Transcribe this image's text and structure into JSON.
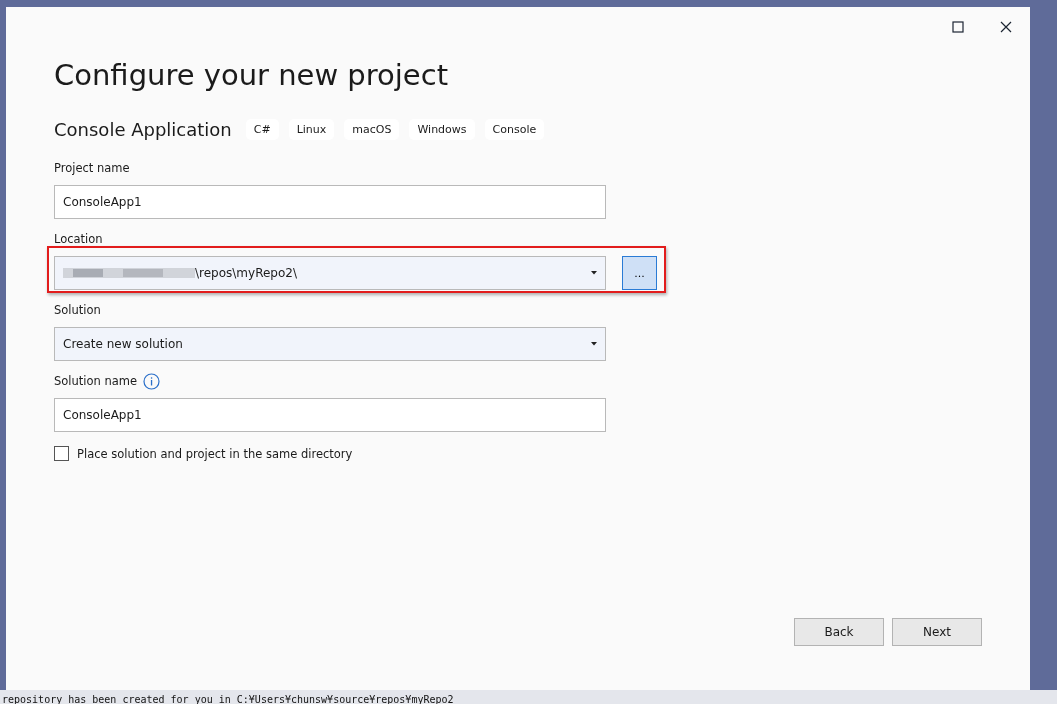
{
  "window": {
    "title": "Configure your new project"
  },
  "template": {
    "name": "Console Application",
    "tags": [
      "C#",
      "Linux",
      "macOS",
      "Windows",
      "Console"
    ]
  },
  "fields": [
    {
      "kind": "text",
      "label": "Project name",
      "value": "ConsoleApp1",
      "highlighted": false
    },
    {
      "kind": "location",
      "label": "Location",
      "value": "\\repos\\myRepo2\\",
      "highlighted": true,
      "browse": "..."
    },
    {
      "kind": "dropdown",
      "label": "Solution",
      "value": "Create new solution",
      "highlighted": false
    },
    {
      "kind": "text",
      "label": "Solution name",
      "value": "ConsoleApp1",
      "info": true,
      "highlighted": false
    }
  ],
  "checkbox": {
    "label": "Place solution and project in the same directory",
    "checked": false
  },
  "buttons": [
    "Back",
    "Next"
  ],
  "background_output": "repository has been created for you in C:¥Users¥chunsw¥source¥repos¥myRepo2"
}
